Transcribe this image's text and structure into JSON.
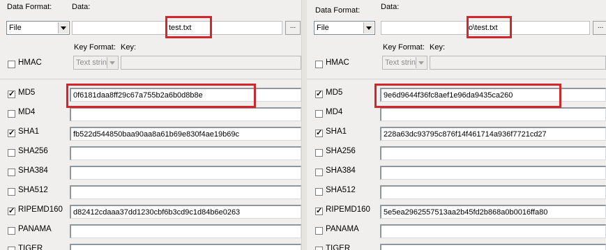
{
  "left": {
    "data_format_label": "Data Format:",
    "data_label": "Data:",
    "data_format_value": "File",
    "data_value": "test.txt",
    "browse_label": "...",
    "hmac_label": "HMAC",
    "key_format_label": "Key Format:",
    "key_label": "Key:",
    "key_format_value": "Text string",
    "rows": [
      {
        "name": "MD5",
        "checked": true,
        "value": "0f6181daa8ff29c67a755b2a6b0d8b8e"
      },
      {
        "name": "MD4",
        "checked": false,
        "value": ""
      },
      {
        "name": "SHA1",
        "checked": true,
        "value": "fb522d544850baa90aa8a61b69e830f4ae19b69c"
      },
      {
        "name": "SHA256",
        "checked": false,
        "value": ""
      },
      {
        "name": "SHA384",
        "checked": false,
        "value": ""
      },
      {
        "name": "SHA512",
        "checked": false,
        "value": ""
      },
      {
        "name": "RIPEMD160",
        "checked": true,
        "value": "d82412cdaaa37dd1230cbf6b3cd9c1d84b6e0263"
      },
      {
        "name": "PANAMA",
        "checked": false,
        "value": ""
      },
      {
        "name": "TIGER",
        "checked": false,
        "value": ""
      }
    ]
  },
  "right": {
    "data_format_label": "Data Format:",
    "data_label": "Data:",
    "data_format_value": "File",
    "data_value": "o\\test.txt",
    "browse_label": "...",
    "hmac_label": "HMAC",
    "key_format_label": "Key Format:",
    "key_label": "Key:",
    "key_format_value": "Text string",
    "rows": [
      {
        "name": "MD5",
        "checked": true,
        "value": "9e6d9644f36fc8aef1e96da9435ca260"
      },
      {
        "name": "MD4",
        "checked": false,
        "value": ""
      },
      {
        "name": "SHA1",
        "checked": true,
        "value": "228a63dc93795c876f14f461714a936f7721cd27"
      },
      {
        "name": "SHA256",
        "checked": false,
        "value": ""
      },
      {
        "name": "SHA384",
        "checked": false,
        "value": ""
      },
      {
        "name": "SHA512",
        "checked": false,
        "value": ""
      },
      {
        "name": "RIPEMD160",
        "checked": true,
        "value": "5e5ea2962557513aa2b45fd2b868a0b0016ffa80"
      },
      {
        "name": "PANAMA",
        "checked": false,
        "value": ""
      },
      {
        "name": "TIGER",
        "checked": false,
        "value": ""
      }
    ]
  },
  "highlight_color": "#d3252a"
}
